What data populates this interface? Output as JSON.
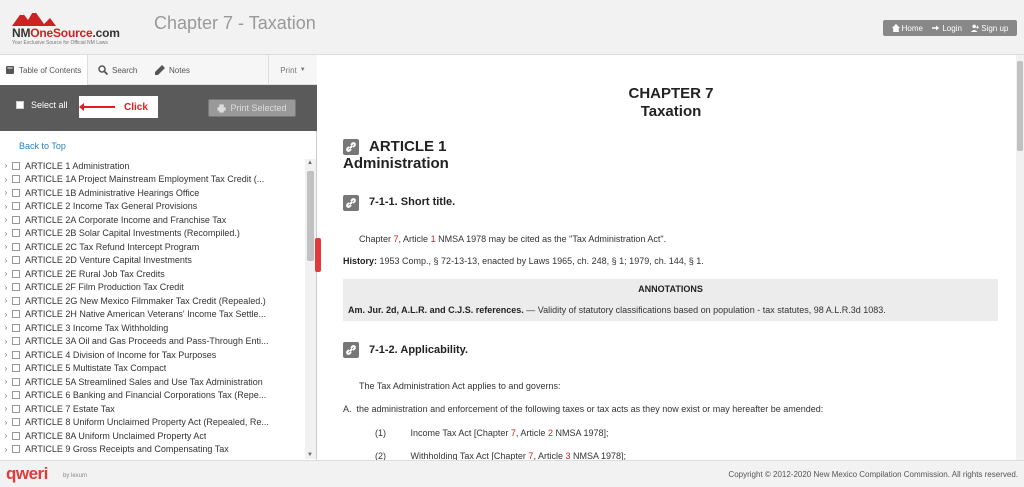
{
  "header": {
    "logo_name_a": "NM",
    "logo_name_b": "OneSource",
    "logo_name_c": ".com",
    "logo_tagline": "Your Exclusive Source for Official NM Laws",
    "title": "Chapter 7 - Taxation",
    "buttons": {
      "home": "Home",
      "login": "Login",
      "signup": "Sign up"
    }
  },
  "sidebar": {
    "tabs": {
      "toc": "Table of Contents",
      "search": "Search",
      "notes": "Notes",
      "print": "Print"
    },
    "select_all": "Select all",
    "callout": "Click",
    "print_selected": "Print Selected",
    "back_to_top": "Back to Top",
    "items": [
      "ARTICLE 1 Administration",
      "ARTICLE 1A Project Mainstream Employment Tax Credit (...",
      "ARTICLE 1B Administrative Hearings Office",
      "ARTICLE 2 Income Tax General Provisions",
      "ARTICLE 2A Corporate Income and Franchise Tax",
      "ARTICLE 2B Solar Capital Investments (Recompiled.)",
      "ARTICLE 2C Tax Refund Intercept Program",
      "ARTICLE 2D Venture Capital Investments",
      "ARTICLE 2E Rural Job Tax Credits",
      "ARTICLE 2F Film Production Tax Credit",
      "ARTICLE 2G New Mexico Filmmaker Tax Credit (Repealed.)",
      "ARTICLE 2H Native American Veterans' Income Tax Settle...",
      "ARTICLE 3 Income Tax Withholding",
      "ARTICLE 3A Oil and Gas Proceeds and Pass-Through Enti...",
      "ARTICLE 4 Division of Income for Tax Purposes",
      "ARTICLE 5 Multistate Tax Compact",
      "ARTICLE 5A Streamlined Sales and Use Tax Administration",
      "ARTICLE 6 Banking and Financial Corporations Tax (Repe...",
      "ARTICLE 7 Estate Tax",
      "ARTICLE 8 Uniform Unclaimed Property Act (Repealed, Re...",
      "ARTICLE 8A Uniform Unclaimed Property Act",
      "ARTICLE 9 Gross Receipts and Compensating Tax"
    ]
  },
  "content": {
    "chapter": "CHAPTER 7",
    "chapter_name": "Taxation",
    "article": "ARTICLE 1",
    "article_name": "Administration",
    "sec1_title": "7-1-1. Short title.",
    "sec1_p1_a": "Chapter ",
    "sec1_p1_b": "7",
    "sec1_p1_c": ", Article ",
    "sec1_p1_d": "1",
    "sec1_p1_e": " NMSA 1978 may be cited as the \"Tax Administration Act\".",
    "history_label": "History:",
    "history_text": " 1953 Comp., § 72-13-13, enacted by Laws 1965, ch. 248, § 1; 1979, ch. 144, § 1.",
    "annotations_title": "ANNOTATIONS",
    "annot_label": "Am. Jur. 2d, A.L.R. and C.J.S. references.",
    "annot_text": " — Validity of statutory classifications based on population - tax statutes, 98 A.L.R.3d 1083.",
    "sec2_title": "7-1-2. Applicability.",
    "sec2_p1": "The Tax Administration Act applies to and governs:",
    "sec2_a_label": "A.",
    "sec2_a_text": "the administration and enforcement of the following taxes or tax acts as they now exist or may hereafter be amended:",
    "item1_num": "(1)",
    "item1_a": "Income Tax Act [Chapter ",
    "item1_b": "7",
    "item1_c": ", Article ",
    "item1_d": "2",
    "item1_e": " NMSA 1978];",
    "item2_num": "(2)",
    "item2_a": "Withholding Tax Act [Chapter ",
    "item2_b": "7",
    "item2_c": ", Article ",
    "item2_d": "3",
    "item2_e": " NMSA 1978];"
  },
  "footer": {
    "brand": "qweri",
    "brand_sub": "by lexum",
    "copyright": "Copyright © 2012-2020 New Mexico Compilation Commission. All rights reserved."
  }
}
